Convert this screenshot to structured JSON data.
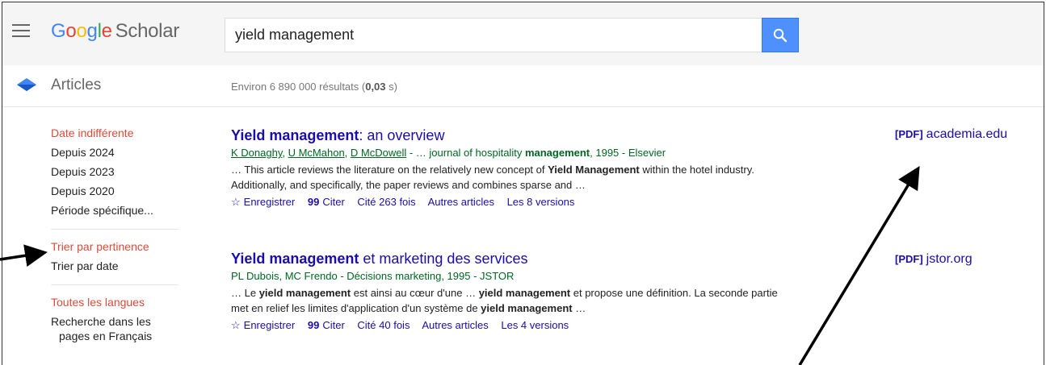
{
  "header": {
    "logo_google": [
      "G",
      "o",
      "o",
      "g",
      "l",
      "e"
    ],
    "logo_scholar": "Scholar",
    "search_value": "yield management"
  },
  "subheader": {
    "section": "Articles",
    "results_prefix": "Environ 6 890 000 résultats (",
    "results_time": "0,03",
    "results_suffix": " s)"
  },
  "sidebar": {
    "date_items": [
      "Date indifférente",
      "Depuis 2024",
      "Depuis 2023",
      "Depuis 2020",
      "Période spécifique..."
    ],
    "sort_items": [
      "Trier par pertinence",
      "Trier par date"
    ],
    "lang_items": [
      "Toutes les langues"
    ],
    "lang_french_line1": "Recherche dans les",
    "lang_french_line2": "pages en Français"
  },
  "results": [
    {
      "title_bold": "Yield management",
      "title_rest": ": an overview",
      "authors": [
        "K Donaghy",
        "U McMahon",
        "D McDowell"
      ],
      "source_pre": " - … journal of hospitality ",
      "source_bold": "management",
      "source_post": ", 1995 - Elsevier",
      "snippet": [
        {
          "t": "… This article reviews the literature on the relatively new concept of ",
          "b": false
        },
        {
          "t": "Yield Management",
          "b": true
        },
        {
          "t": " within the hotel industry. Additionally, and specifically, the paper reviews and combines sparse and …",
          "b": false
        }
      ],
      "links": {
        "save": "Enregistrer",
        "cite": "Citer",
        "cited": "Cité 263 fois",
        "related": "Autres articles",
        "versions": "Les 8 versions"
      },
      "pdf_tag": "[PDF]",
      "pdf_source": "academia.edu"
    },
    {
      "title_bold": "Yield management",
      "title_rest": " et marketing des services",
      "authors_plain": "PL Dubois, MC Frendo - Décisions marketing, 1995 - JSTOR",
      "snippet": [
        {
          "t": "… Le ",
          "b": false
        },
        {
          "t": "yield management",
          "b": true
        },
        {
          "t": " est ainsi au cœur d'une … ",
          "b": false
        },
        {
          "t": "yield management",
          "b": true
        },
        {
          "t": " et propose une définition. La seconde partie met en relief les limites d'application d'un système de ",
          "b": false
        },
        {
          "t": "yield management",
          "b": true
        },
        {
          "t": " …",
          "b": false
        }
      ],
      "links": {
        "save": "Enregistrer",
        "cite": "Citer",
        "cited": "Cité 40 fois",
        "related": "Autres articles",
        "versions": "Les 4 versions"
      },
      "pdf_tag": "[PDF]",
      "pdf_source": "jstor.org"
    }
  ],
  "colors": {
    "link": "#1a0dab",
    "active_filter": "#dd4b39",
    "author_green": "#006621",
    "search_button": "#4d90fe"
  }
}
